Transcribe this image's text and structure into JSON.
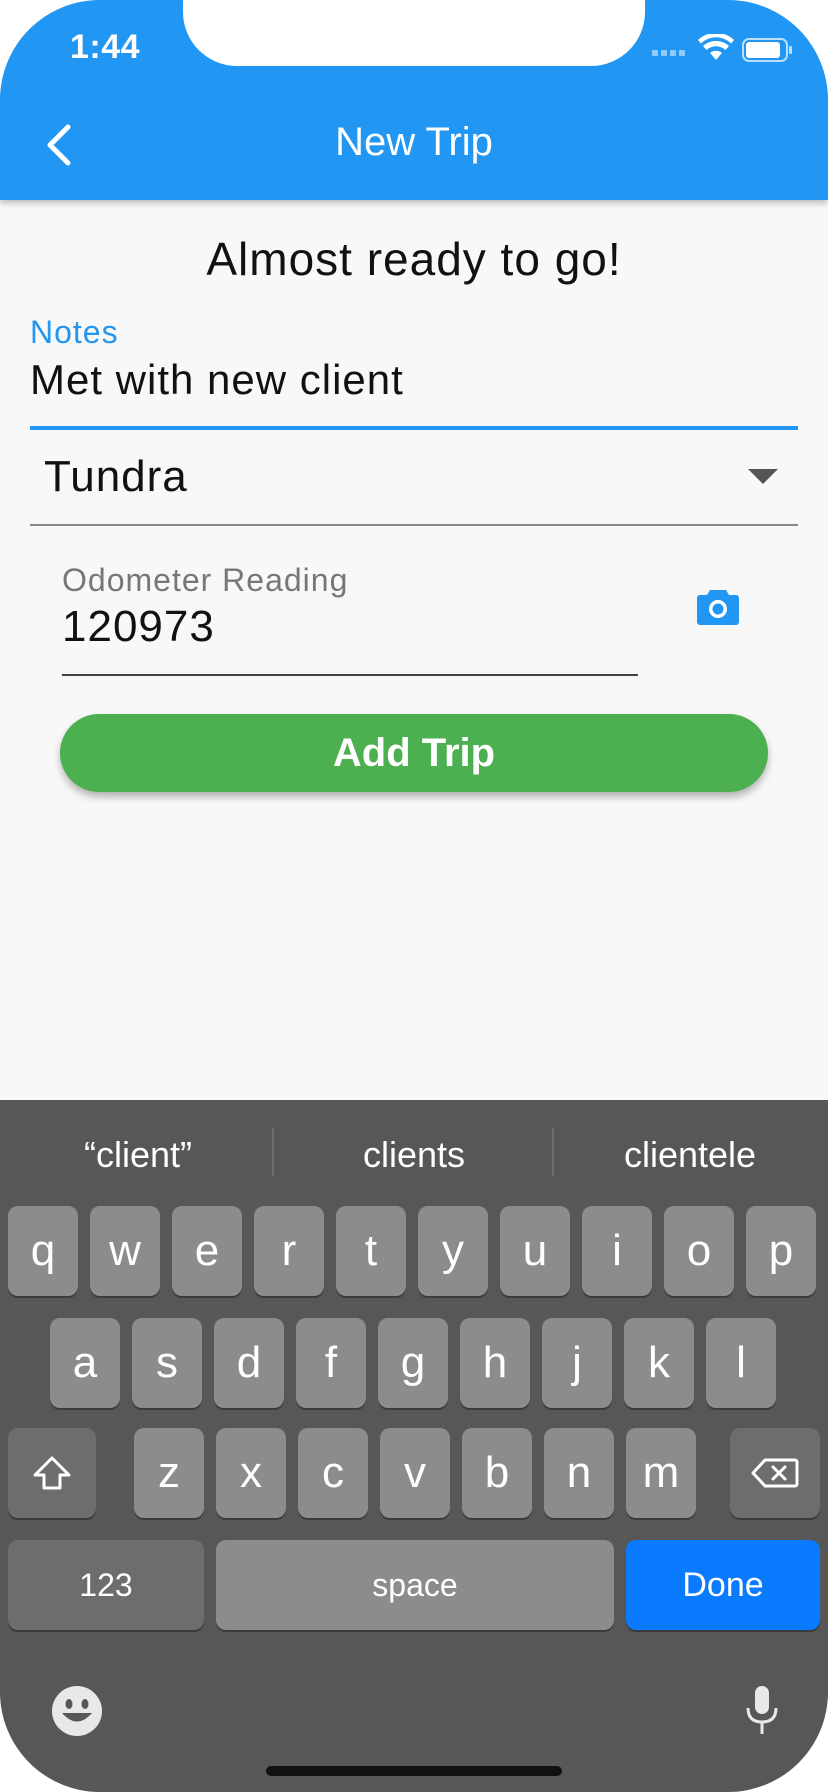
{
  "status_bar": {
    "time": "1:44"
  },
  "app_bar": {
    "title": "New Trip"
  },
  "main": {
    "heading": "Almost ready to go!",
    "notes": {
      "label": "Notes",
      "value": "Met with new client"
    },
    "vehicle": {
      "value": "Tundra"
    },
    "odometer": {
      "label": "Odometer Reading",
      "value": "120973"
    },
    "add_trip_label": "Add Trip"
  },
  "keyboard": {
    "suggestions": [
      "“client”",
      "clients",
      "clientele"
    ],
    "row1": [
      "q",
      "w",
      "e",
      "r",
      "t",
      "y",
      "u",
      "i",
      "o",
      "p"
    ],
    "row2": [
      "a",
      "s",
      "d",
      "f",
      "g",
      "h",
      "j",
      "k",
      "l"
    ],
    "row3": [
      "z",
      "x",
      "c",
      "v",
      "b",
      "n",
      "m"
    ],
    "numbers_label": "123",
    "space_label": "space",
    "done_label": "Done"
  },
  "colors": {
    "primary": "#2196f3",
    "add_trip": "#4caf50",
    "done_key": "#0a7aff",
    "keyboard_bg": "#575757"
  }
}
